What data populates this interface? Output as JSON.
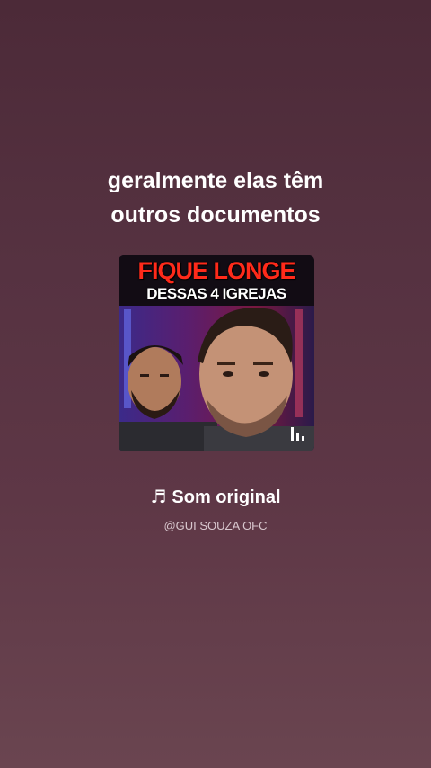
{
  "caption": {
    "line1": "geralmente elas têm",
    "line2": "outros documentos"
  },
  "thumbnail": {
    "title_line1": "FIQUE LONGE",
    "title_line2": "DESSAS 4 IGREJAS",
    "title_color": "#ff2a1a",
    "overlay_icon": "equalizer-icon"
  },
  "sound": {
    "icon": "music-note-icon",
    "icon_glyph": "♬",
    "title": "Som original",
    "author": "@GUI SOUZA OFC"
  },
  "colors": {
    "background_top": "#4c2a38",
    "background_bottom": "#6a4550",
    "text": "#ffffff",
    "subtext": "#d9c8cf"
  }
}
